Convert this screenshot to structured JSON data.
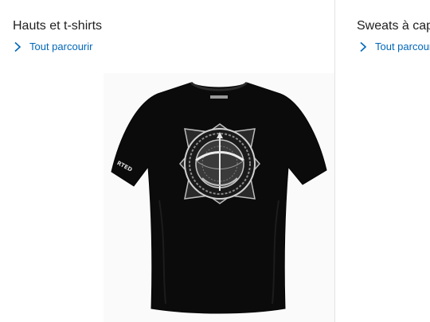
{
  "cards": [
    {
      "title": "Hauts et t-shirts",
      "link_label": "Tout parcourir",
      "link_icon": "chevron-right-icon",
      "image": {
        "description_icon": "tshirt-image",
        "emblem": "bow-and-arrow-emblem",
        "sleeve_print": "RTED"
      }
    },
    {
      "title": "Sweats à cap",
      "link_label": "Tout parcour",
      "link_icon": "chevron-right-icon"
    }
  ],
  "colors": {
    "link": "#0067b8",
    "title": "#1f1f1f",
    "divider": "#e3e3e3",
    "shirt": "#0b0b0b"
  }
}
